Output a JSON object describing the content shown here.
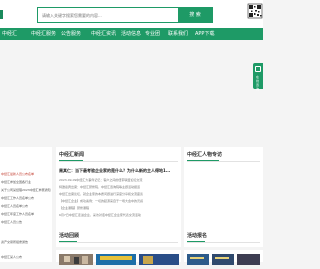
{
  "search": {
    "placeholder": "请输入关键字搜索您需要的内容...",
    "button_label": "搜 索"
  },
  "nav": {
    "items": [
      "中经汇",
      "中经汇服务",
      "公告服务",
      "中经汇资讯",
      "活动信息",
      "专业团",
      "联系我们",
      "APP下载"
    ]
  },
  "side_tab": {
    "label": "在线咨询"
  },
  "left_list": {
    "items": [
      "中经汇最新人员公布名单",
      "中经汇参加全国各行业",
      "关于公司某经理2023中经汇参赛通知",
      "中经汇工作人员名单公布",
      "中经汇人员名单公布",
      "中经汇年度工作人员名单",
      "中经汇人员公告",
      "资产交易所组委通告",
      "中经汇某人公布",
      "中经汇人员名单公布名单"
    ]
  },
  "news": {
    "title": "中经汇新闻",
    "more": "更多>>",
    "headline": "周其仁：当下最考验企业家的是什么？为什么新的主人得地1...",
    "lines": [
      "2023-09-09中经汇大事件记忆：客户之间的纽带联盟论坛交流",
      "特邀嘉宾出席：中经汇研修院、中经汇咨询院等主题活动报道",
      "中经汇出席论坛，就企业家的本质问题进行深度分享和交流座谈",
      "【中经汇企业】成功案例：一切的起源来自于一场大会中的灵感",
      "【企业课程】研修课程",
      "6月7日中经汇走进企业，采访对话中经汇企业家代表交流活动"
    ],
    "sub_title": "活动回顾"
  },
  "right_panel": {
    "title": "中经汇人物专访",
    "sub_title": "活动报名"
  },
  "colors": {
    "brand_green": "#1e9a66",
    "accent_red": "#c0392b"
  }
}
